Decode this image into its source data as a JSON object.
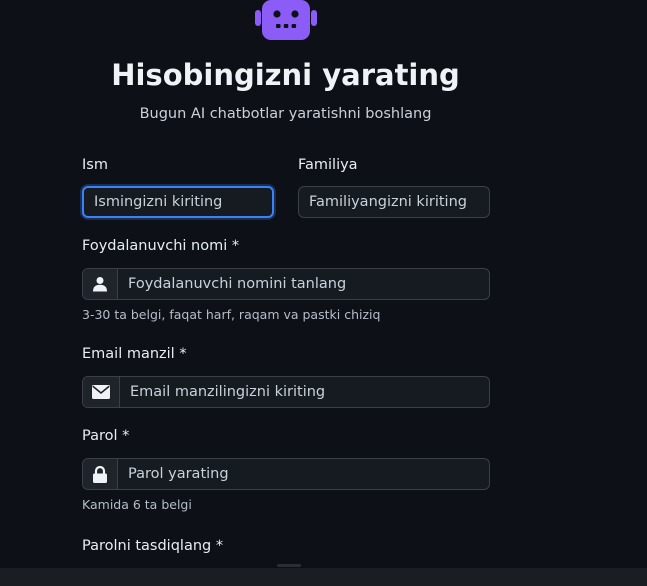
{
  "header": {
    "title": "Hisobingizni yarating",
    "subtitle": "Bugun AI chatbotlar yaratishni boshlang",
    "logo_icon": "robot-icon",
    "accent_color": "#8b5cf6"
  },
  "form": {
    "first_name": {
      "label": "Ism",
      "placeholder": "Ismingizni kiriting"
    },
    "last_name": {
      "label": "Familiya",
      "placeholder": "Familiyangizni kiriting"
    },
    "username": {
      "label": "Foydalanuvchi nomi *",
      "placeholder": "Foydalanuvchi nomini tanlang",
      "icon": "user-icon",
      "hint": "3-30 ta belgi, faqat harf, raqam va pastki chiziq"
    },
    "email": {
      "label": "Email manzil *",
      "placeholder": "Email manzilingizni kiriting",
      "icon": "envelope-icon"
    },
    "password": {
      "label": "Parol *",
      "placeholder": "Parol yarating",
      "icon": "lock-icon",
      "hint": "Kamida 6 ta belgi"
    },
    "confirm_password": {
      "label": "Parolni tasdiqlang *"
    }
  },
  "colors": {
    "background": "#0d1117",
    "input_bg": "#161b22",
    "border": "#3a4048",
    "focus": "#3b82f6"
  }
}
